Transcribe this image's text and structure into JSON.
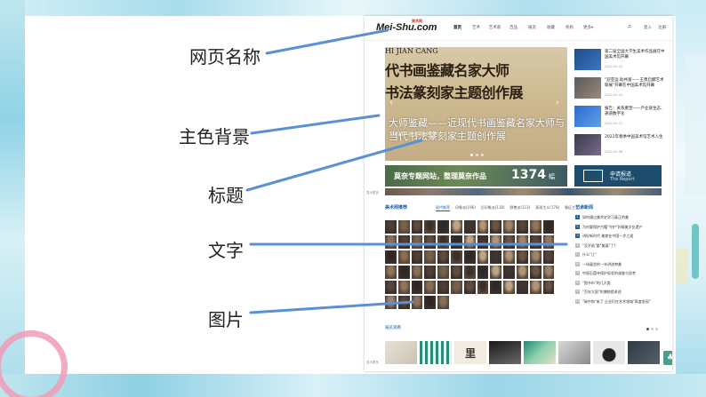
{
  "annotations": {
    "site_name": "网页名称",
    "main_bg": "主色背景",
    "title": "标题",
    "text": "文字",
    "image": "图片"
  },
  "colors": {
    "accent_blue": "#1a5fa8",
    "slide_teal": "#8fd3e6",
    "ring_pink": "#f29bb6",
    "connector_blue": "#5b8fd6"
  },
  "site": {
    "logo": "Mei-Shu.com",
    "logo_sub": "美术网",
    "nav": [
      "首页",
      "艺术",
      "艺术家",
      "百品",
      "展览",
      "收藏",
      "机构",
      "更多"
    ],
    "nav_more_icon": "chevron-down-icon",
    "search_icon": "search-icon",
    "login": "登入",
    "register": "注册",
    "hero": {
      "calligraphy_pinyin": "HI JIAN CANG",
      "calligraphy_line1": "代书画鉴藏名家大师",
      "calligraphy_line2": "书法篆刻家主题创作展",
      "caption": "大师鉴藏——近现代书画鉴藏名家大师与当代书法篆刻家主题创作展",
      "date": "2022.01.26 2022.02.26",
      "prev_icon": "chevron-left-icon",
      "next_icon": "chevron-right-icon"
    },
    "news": [
      {
        "title": "第二届全国大学生美术作品展在中国美术馆开幕",
        "date": "2022-01-13"
      },
      {
        "title": "\"迎亚运 助共富——王勇启麟艺术联展\"开幕在中国美术馆开幕",
        "date": "2022-01-14"
      },
      {
        "title": "报告：关系重塑——产业链生态、通道数字化",
        "date": "2022-01-11"
      },
      {
        "title": "2022年春季中国美术馆艺术人生",
        "date": "2022-01-08"
      }
    ],
    "banner": {
      "text": "莫奈专题网站，整理莫奈作品",
      "number": "1374",
      "unit": "幅"
    },
    "report": {
      "cn": "申请报道",
      "en": "The Report"
    },
    "side_tag": "显示更多",
    "artists_head": "美术网推荐",
    "tabs": [
      "现代推荐",
      "印象派(196)",
      "后印象派(118)",
      "野兽派(113)",
      "表现主义(178)",
      "象征主义(11)"
    ],
    "hot_head": "艺术新闻",
    "hot": [
      "如何通过美术史学习真正的美",
      "为何要保护古籍\"守护\"好精美文化遗产",
      "讲好新时代 美育在中国一步之遥",
      "\"没学画\"要\"美展\"了?",
      "什么\"江\"",
      "一场展览的一年讲述审美",
      "中国石窟寺保护现状的调查与思考",
      "\"图书市\"的几大类",
      "\"百年大国\"的博物馆讲述",
      "\"碳中和\"来了 企业们在艺术领域\"再度发现\""
    ],
    "recent_head": "展览观看",
    "recent_glyph": "里",
    "bottom_icon": "tree-icon"
  }
}
